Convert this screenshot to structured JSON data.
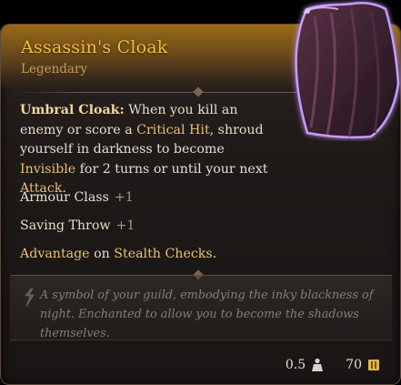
{
  "item": {
    "name": "Assassin's Cloak",
    "rarity": "Legendary"
  },
  "description": {
    "ability_name": "Umbral Cloak:",
    "part1": " When you kill an enemy or score a ",
    "kw_critical": "Critical Hit",
    "part2": ", shroud yourself in darkness to become ",
    "kw_invisible": "Invisible",
    "part3": " for 2 turns or until your next ",
    "kw_attack": "Attack",
    "part4": "."
  },
  "stats": [
    {
      "label": "Armour Class",
      "value": "+1"
    },
    {
      "label": "Saving Throw",
      "value": "+1"
    }
  ],
  "advantage": {
    "prefix": "Advantage",
    "middle": " on ",
    "skill": "Stealth",
    "space": " ",
    "checks": "Checks",
    "period": "."
  },
  "flavor": "A symbol of your guild, embodying the inky blackness of night. Enchanted to allow you to become the shadows themselves.",
  "footer": {
    "weight": "0.5",
    "price": "70"
  },
  "colors": {
    "title": "#f2bc47",
    "rarity": "#c89a55",
    "keyword": "#e8c074",
    "cloak_glow": "#c79bff"
  },
  "icons": {
    "item": "cloak-icon",
    "weight": "weight-icon",
    "price": "gold-coin-icon",
    "flavor": "quote-icon"
  }
}
